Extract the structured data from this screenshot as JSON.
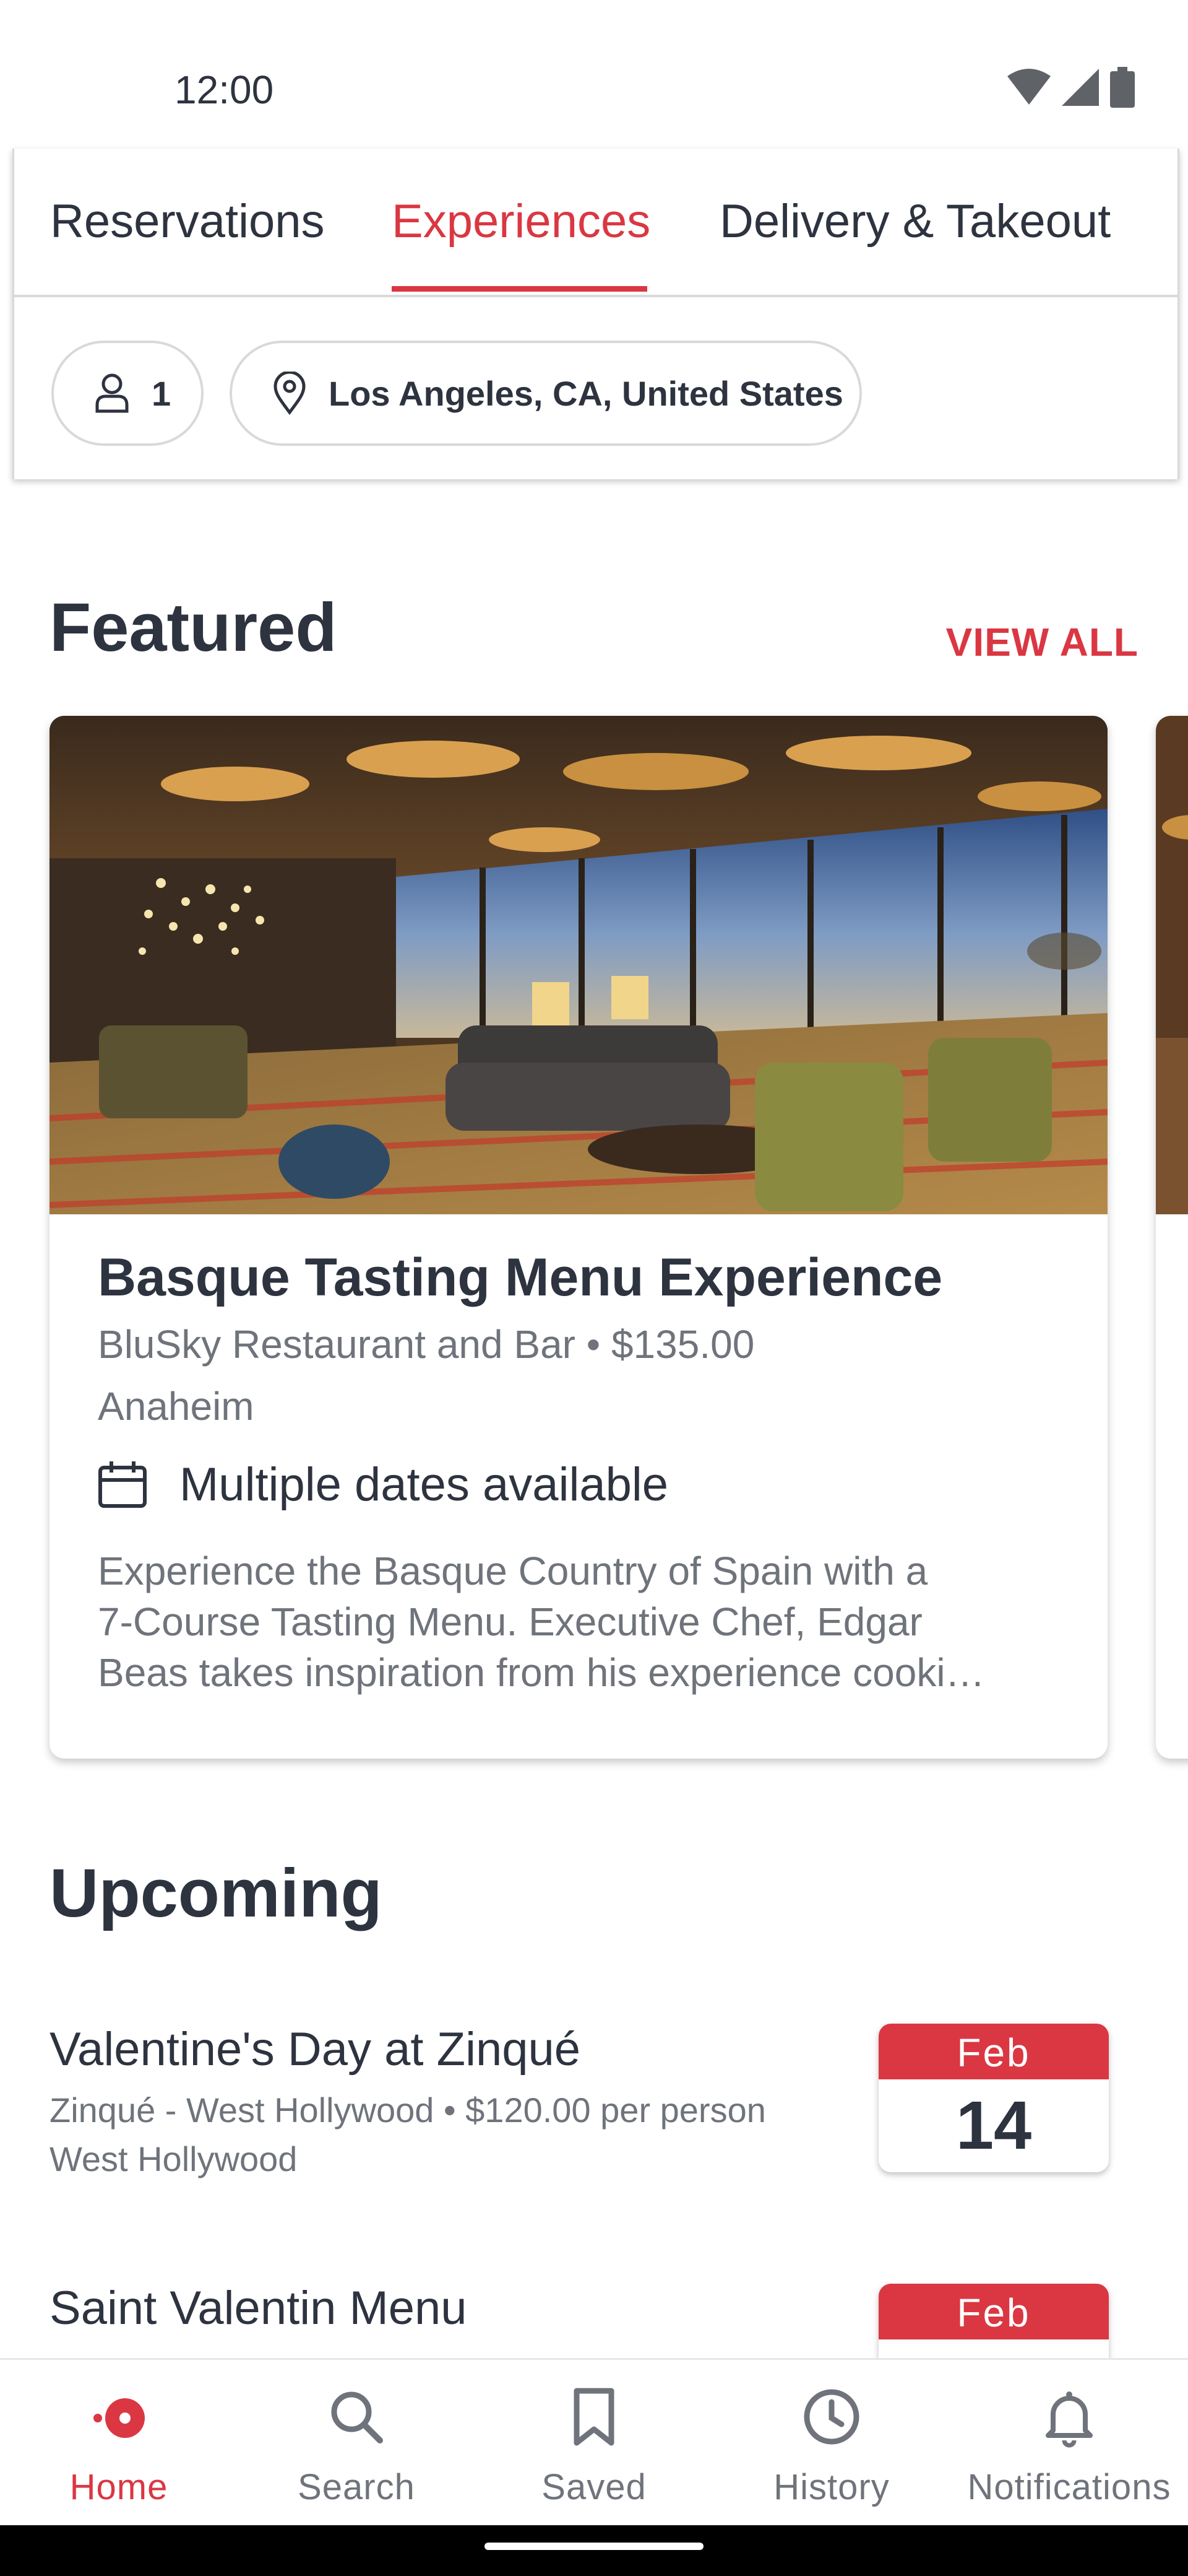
{
  "status_bar": {
    "time": "12:00"
  },
  "tabs": [
    {
      "label": "Reservations",
      "active": false
    },
    {
      "label": "Experiences",
      "active": true
    },
    {
      "label": "Delivery & Takeout",
      "active": false
    }
  ],
  "filters": {
    "party_size": "1",
    "location": "Los Angeles, CA, United States"
  },
  "featured": {
    "title": "Featured",
    "view_all": "VIEW ALL",
    "card": {
      "title": "Basque Tasting Menu Experience",
      "subtitle": "BluSky Restaurant and Bar • $135.00",
      "city": "Anaheim",
      "dates": "Multiple dates available",
      "description_lines": [
        "Experience the Basque Country of Spain with a",
        "7-Course Tasting Menu. Executive Chef, Edgar",
        "Beas takes inspiration from his experience cooki…"
      ]
    }
  },
  "upcoming": {
    "title": "Upcoming",
    "items": [
      {
        "title": "Valentine's Day at Zinqué",
        "subtitle": "Zinqué - West Hollywood • $120.00 per person",
        "city": "West Hollywood",
        "month": "Feb",
        "day": "14"
      },
      {
        "title": "Saint Valentin Menu",
        "subtitle": "",
        "city": "",
        "month": "Feb",
        "day": ""
      }
    ]
  },
  "bottom_nav": [
    {
      "label": "Home",
      "icon": "home-icon",
      "active": true
    },
    {
      "label": "Search",
      "icon": "search-icon",
      "active": false
    },
    {
      "label": "Saved",
      "icon": "bookmark-icon",
      "active": false
    },
    {
      "label": "History",
      "icon": "clock-icon",
      "active": false
    },
    {
      "label": "Notifications",
      "icon": "bell-icon",
      "active": false
    }
  ],
  "colors": {
    "accent": "#da3743",
    "text": "#2d333f",
    "muted": "#6f737b",
    "border": "#d8d9db"
  }
}
